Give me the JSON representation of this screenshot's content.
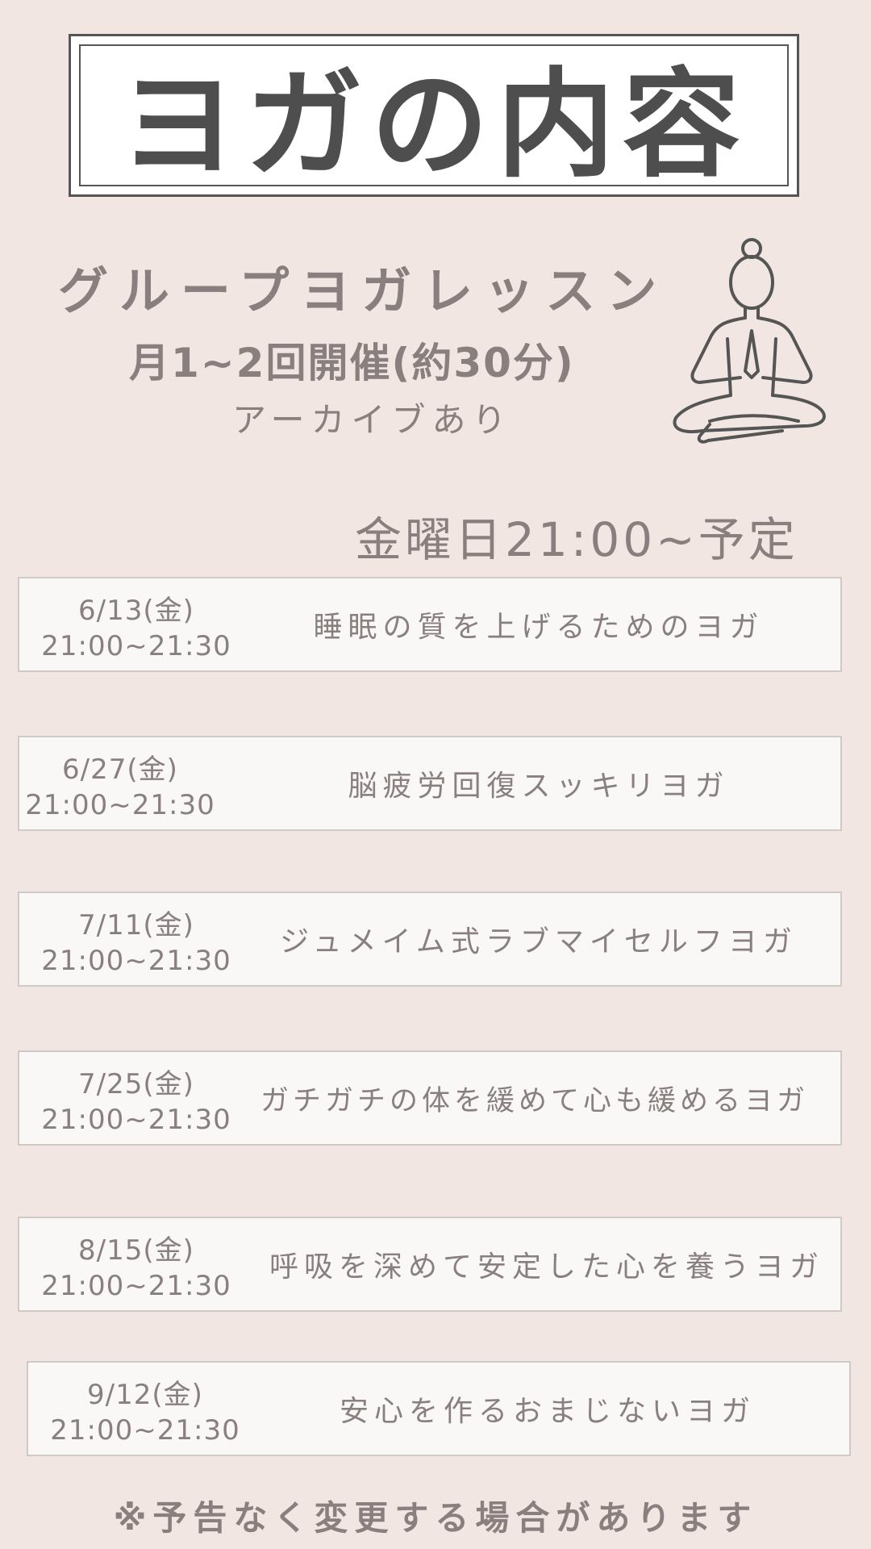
{
  "title": "ヨガの内容",
  "lesson": {
    "name": "グループヨガレッスン",
    "frequency": "月1~2回開催(約30分)",
    "archive": "アーカイブあり"
  },
  "schedule_note": "金曜日21:00~予定",
  "sessions": [
    {
      "date": "6/13(金)",
      "time": "21:00~21:30",
      "topic": "睡眠の質を上げるためのヨガ"
    },
    {
      "date": "6/27(金)",
      "time": "21:00~21:30",
      "topic": "脳疲労回復スッキリヨガ"
    },
    {
      "date": "7/11(金)",
      "time": "21:00~21:30",
      "topic": "ジュメイム式ラブマイセルフヨガ"
    },
    {
      "date": "7/25(金)",
      "time": "21:00~21:30",
      "topic": "ガチガチの体を緩めて心も緩めるヨガ"
    },
    {
      "date": "8/15(金)",
      "time": "21:00~21:30",
      "topic": "呼吸を深めて安定した心を養うヨガ"
    },
    {
      "date": "9/12(金)",
      "time": "21:00~21:30",
      "topic": "安心を作るおまじないヨガ"
    }
  ],
  "footer": "※予告なく変更する場合があります",
  "icons": {
    "figure": "meditating-woman-icon"
  },
  "colors": {
    "background": "#f2e6e3",
    "title_text": "#4e4e4e",
    "body_text": "#8a7f7f",
    "card_bg": "#faf8f7"
  }
}
